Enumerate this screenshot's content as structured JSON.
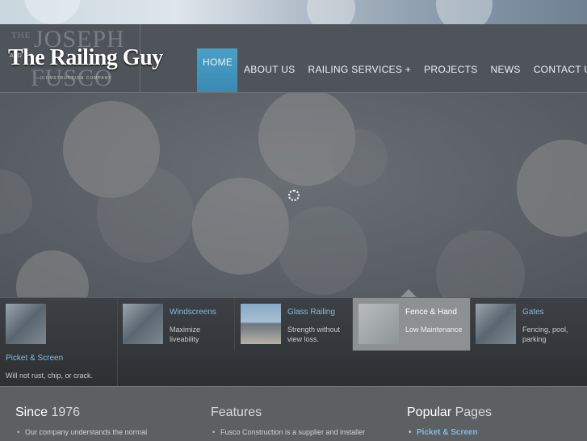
{
  "brand": {
    "logo_main": "The Railing Guy",
    "logo_top_word": "THE",
    "logo_first_name": "JOSEPH",
    "logo_last_name": "FUSCO",
    "logo_and": "AND",
    "logo_tagline": "CONSTRUCTION COMPANY"
  },
  "nav": {
    "items": [
      {
        "label": "HOME",
        "active": true
      },
      {
        "label": "ABOUT US"
      },
      {
        "label": "RAILING SERVICES +"
      },
      {
        "label": "PROJECTS"
      },
      {
        "label": "NEWS"
      },
      {
        "label": "CONTACT US"
      }
    ]
  },
  "slider": {
    "loading_icon": "spinner-icon"
  },
  "thumbs": [
    {
      "title": "Picket & Screen",
      "desc": "Will not rust, chip, or crack."
    },
    {
      "title": "Windscreens",
      "desc": "Maximize liveability"
    },
    {
      "title": "Glass Railing",
      "desc": "Strength without view loss."
    },
    {
      "title": "Fence & Hand",
      "desc": "Low Maintenance",
      "active": true
    },
    {
      "title": "Gates",
      "desc": "Fencing, pool, parking"
    }
  ],
  "footer": {
    "col1": {
      "title_a": "Since",
      "title_b": " 1976",
      "item": "Our company understands the normal"
    },
    "col2": {
      "title": "Features",
      "item": "Fusco Construction is a supplier and installer"
    },
    "col3": {
      "title_a": "Popular",
      "title_b": " Pages",
      "item": "Picket & Screen"
    }
  },
  "colors": {
    "accent": "#3a8ab3",
    "link": "#7fbde0",
    "header_bg": "#4e545a"
  }
}
